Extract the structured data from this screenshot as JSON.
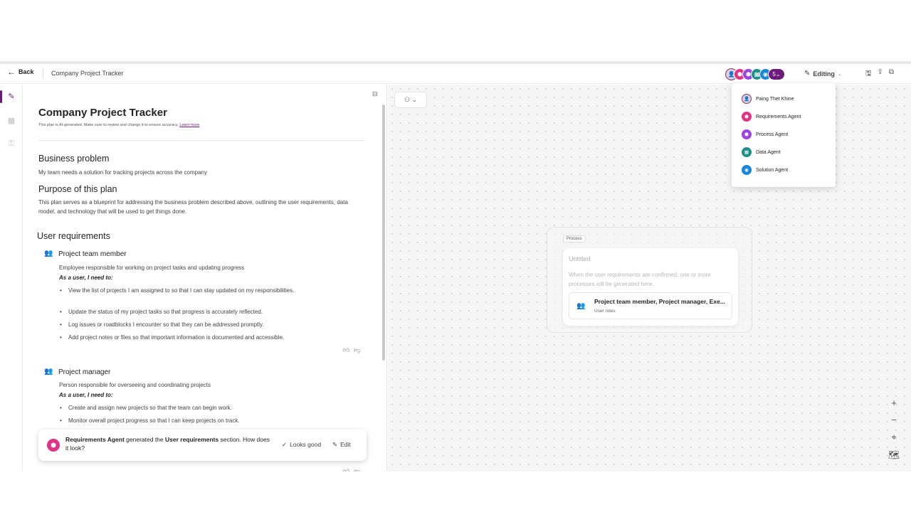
{
  "topbar": {
    "back_label": "Back",
    "breadcrumb": "Company Project Tracker",
    "avatar_more": "5",
    "editing_label": "Editing"
  },
  "doc": {
    "title": "Company Project Tracker",
    "ai_note": "This plan is AI-generated. Make sure to review and change it to ensure accuracy.",
    "learn_more": "Learn more",
    "business_problem_heading": "Business problem",
    "business_problem_text": "My team needs a solution for tracking projects across the company",
    "purpose_heading": "Purpose of this plan",
    "purpose_text": "This plan serves as a blueprint for addressing the business problem described above, outlining the user requirements, data model, and technology that will be used to get things done.",
    "user_req_heading": "User requirements",
    "roles": [
      {
        "name": "Project team member",
        "description": "Employee responsible for working on project tasks and updating progress",
        "need_label": "As a user, I need to:",
        "needs": [
          "View the list of projects I am assigned to so that I can stay updated on my responsibilities.",
          "Update the status of my project tasks so that progress is accurately reflected.",
          "Log issues or roadblocks I encounter so that they can be addressed promptly.",
          "Add project notes or files so that important information is documented and accessible."
        ]
      },
      {
        "name": "Project manager",
        "description": "Person responsible for overseeing and coordinating projects",
        "need_label": "As a user, I need to:",
        "needs": [
          "Create and assign new projects so that the team can begin work.",
          "Monitor overall project progress so that I can keep projects on track."
        ]
      }
    ]
  },
  "toast": {
    "agent": "Requirements Agent",
    "text_mid": " generated the ",
    "section": "User requirements",
    "text_end": " section. How does it look?",
    "looks_good": "Looks good",
    "edit": "Edit"
  },
  "canvas": {
    "process_tag": "Process",
    "process_title": "Untitled",
    "process_desc": "When the user requirements are confirmed, one or more processes will be generated here.",
    "role_card_title": "Project team member, Project manager, Exe...",
    "role_card_sub": "User roles"
  },
  "dropdown": {
    "items": [
      {
        "label": "Paing Thet Khine",
        "icon": "user-avatar-icon",
        "color": "#d9d0e3"
      },
      {
        "label": "Requirements Agent",
        "icon": "requirements-agent-icon",
        "color": "#e13386"
      },
      {
        "label": "Process Agent",
        "icon": "process-agent-icon",
        "color": "#9a45e3"
      },
      {
        "label": "Data Agent",
        "icon": "data-agent-icon",
        "color": "#1f8f86"
      },
      {
        "label": "Solution Agent",
        "icon": "solution-agent-icon",
        "color": "#1a86d8"
      }
    ]
  },
  "colors": {
    "brand": "#6d1a7a",
    "role_icon": "#3b6ee3"
  }
}
